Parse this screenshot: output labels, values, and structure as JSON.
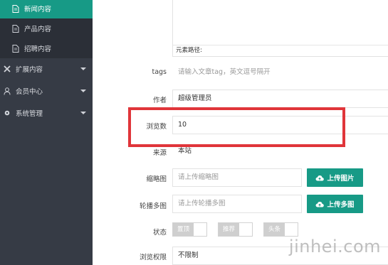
{
  "sidebar": {
    "items": [
      {
        "label": "新闻内容",
        "icon": "document-icon",
        "active": true
      },
      {
        "label": "产品内容",
        "icon": "document-icon",
        "active": false
      },
      {
        "label": "招聘内容",
        "icon": "document-icon",
        "active": false
      },
      {
        "label": "扩展内容",
        "icon": "tools-icon",
        "expandable": true
      },
      {
        "label": "会员中心",
        "icon": "user-icon",
        "expandable": true
      },
      {
        "label": "系统管理",
        "icon": "gear-icon",
        "expandable": true
      }
    ]
  },
  "editor": {
    "path_label": "元素路径:"
  },
  "form": {
    "tags": {
      "label": "tags",
      "placeholder": "请输入文章tag，英文逗号隔开"
    },
    "author": {
      "label": "作者",
      "value": "超级管理员"
    },
    "views": {
      "label": "浏览数",
      "value": "10"
    },
    "source": {
      "label": "来源",
      "value": "本站"
    },
    "thumbnail": {
      "label": "缩略图",
      "placeholder": "请上传缩略图",
      "button": "上传图片"
    },
    "carousel": {
      "label": "轮播多图",
      "placeholder": "请上传轮播多图",
      "button": "上传多图"
    },
    "status": {
      "label": "状态",
      "options": [
        "置顶",
        "推荐",
        "头条"
      ]
    },
    "permission": {
      "label": "浏览权限",
      "value": "不限制"
    }
  },
  "watermark": "jinhei.com",
  "colors": {
    "accent": "#179a86",
    "sidebar": "#363b45",
    "highlight": "#e0353a"
  }
}
